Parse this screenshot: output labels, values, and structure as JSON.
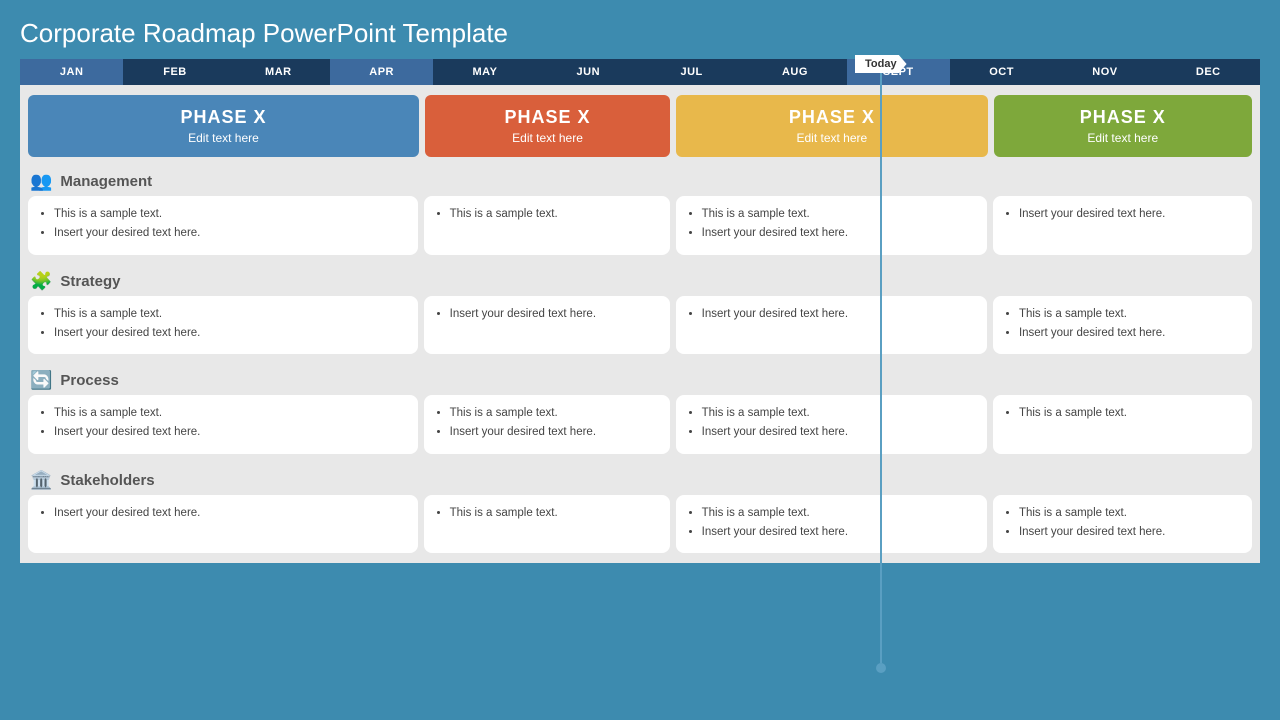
{
  "title": "Corporate Roadmap PowerPoint Template",
  "today": {
    "label": "Today"
  },
  "months": [
    {
      "label": "JAN",
      "active": true
    },
    {
      "label": "FEB",
      "active": false
    },
    {
      "label": "MAR",
      "active": false
    },
    {
      "label": "APR",
      "active": true
    },
    {
      "label": "MAY",
      "active": false
    },
    {
      "label": "JUN",
      "active": false
    },
    {
      "label": "JUL",
      "active": false
    },
    {
      "label": "AUG",
      "active": false
    },
    {
      "label": "SEPT",
      "active": true
    },
    {
      "label": "OCT",
      "active": false
    },
    {
      "label": "NOV",
      "active": false
    },
    {
      "label": "DEC",
      "active": false
    }
  ],
  "phases": [
    {
      "label": "PHASE X",
      "sub": "Edit text here",
      "class": "phase-1"
    },
    {
      "label": "PHASE X",
      "sub": "Edit text here",
      "class": "phase-2"
    },
    {
      "label": "PHASE X",
      "sub": "Edit text here",
      "class": "phase-3"
    },
    {
      "label": "PHASE X",
      "sub": "Edit text here",
      "class": "phase-4"
    }
  ],
  "sections": [
    {
      "name": "Management",
      "icon": "👥",
      "cards": [
        {
          "items": [
            "This is a sample text.",
            "Insert your desired text here."
          ]
        },
        {
          "items": [
            "This is a sample text."
          ]
        },
        {
          "items": [
            "This is a sample text.",
            "Insert your desired text here."
          ]
        },
        {
          "items": [
            "Insert your desired text here."
          ]
        }
      ]
    },
    {
      "name": "Strategy",
      "icon": "🧩",
      "cards": [
        {
          "items": [
            "This is a sample text.",
            "Insert your desired text here."
          ]
        },
        {
          "items": [
            "Insert your desired text here."
          ]
        },
        {
          "items": [
            "Insert your desired text here."
          ]
        },
        {
          "items": [
            "This is a sample text.",
            "Insert your desired text here."
          ]
        }
      ]
    },
    {
      "name": "Process",
      "icon": "🔄",
      "cards": [
        {
          "items": [
            "This is a sample text.",
            "Insert your desired text here."
          ]
        },
        {
          "items": [
            "This is a sample text.",
            "Insert your desired text here."
          ]
        },
        {
          "items": [
            "This is a sample text.",
            "Insert your desired text here."
          ]
        },
        {
          "items": [
            "This is a sample text."
          ]
        }
      ]
    },
    {
      "name": "Stakeholders",
      "icon": "🏛️",
      "cards": [
        {
          "items": [
            "Insert your desired text here."
          ]
        },
        {
          "items": [
            "This is a sample text."
          ]
        },
        {
          "items": [
            "This is a sample text.",
            "Insert your desired text here."
          ]
        },
        {
          "items": [
            "This is a sample text.",
            "Insert your desired text here."
          ]
        }
      ]
    }
  ]
}
